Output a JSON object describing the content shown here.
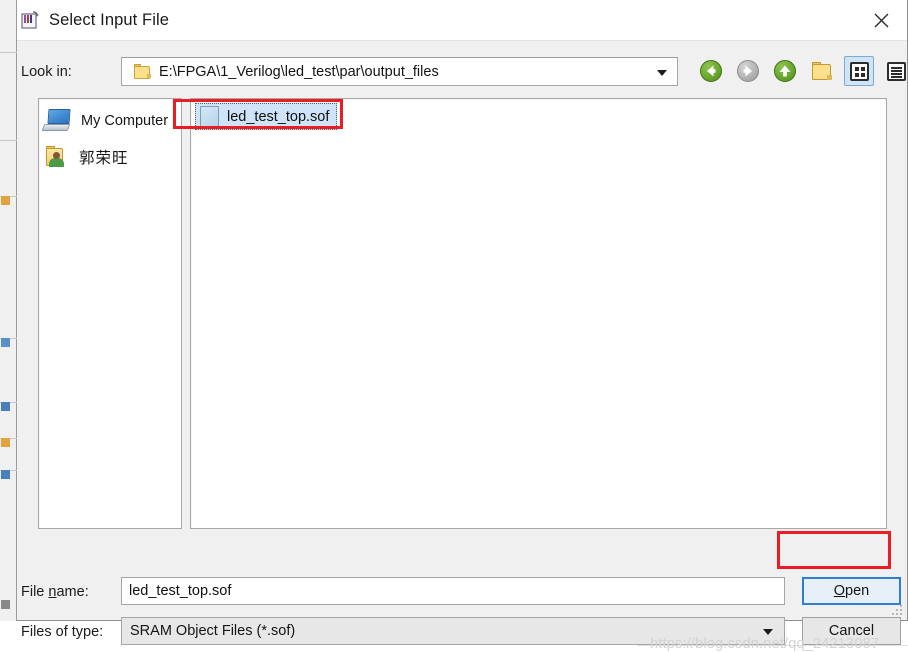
{
  "window": {
    "title": "Select Input File",
    "title_icon": "quartus-programmer-icon",
    "close_icon": "close-icon"
  },
  "lookin": {
    "label": "Look in:",
    "path": "E:\\FPGA\\1_Verilog\\led_test\\par\\output_files",
    "folder_icon": "folder-icon",
    "dropdown_icon": "chevron-down-icon"
  },
  "toolbar": {
    "buttons": [
      {
        "name": "back-button",
        "icon": "arrow-left-circle-icon",
        "state": "enabled"
      },
      {
        "name": "forward-button",
        "icon": "arrow-right-circle-icon",
        "state": "disabled"
      },
      {
        "name": "parent-directory-button",
        "icon": "arrow-up-circle-icon",
        "state": "enabled"
      },
      {
        "name": "new-folder-button",
        "icon": "folder-new-icon",
        "state": "enabled"
      },
      {
        "name": "list-view-button",
        "icon": "grid-view-icon",
        "state": "selected"
      },
      {
        "name": "detail-view-button",
        "icon": "list-detail-icon",
        "state": "enabled"
      }
    ]
  },
  "places": {
    "items": [
      {
        "label": "My Computer",
        "icon": "computer-icon"
      },
      {
        "label": "郭荣旺",
        "icon": "user-folder-icon"
      }
    ]
  },
  "file_list": {
    "files": [
      {
        "name": "led_test_top.sof",
        "icon": "sof-file-icon",
        "selected": true
      }
    ]
  },
  "file_name": {
    "label_before": "File ",
    "label_mnemonic": "n",
    "label_after": "ame:",
    "value": "led_test_top.sof",
    "placeholder": ""
  },
  "files_of_type": {
    "label": "Files of type:",
    "value": "SRAM Object Files (*.sof)",
    "dropdown_icon": "chevron-down-icon"
  },
  "buttons": {
    "open": {
      "mnemonic": "O",
      "rest": "pen",
      "focused": true
    },
    "cancel": {
      "label": "Cancel"
    }
  },
  "annotations": [
    {
      "name": "annotation-file-row",
      "color": "#ec1c24"
    },
    {
      "name": "annotation-open-button",
      "color": "#ec1c24"
    }
  ],
  "watermark": {
    "text": "https://blog.csdn.net/qq_24213087"
  },
  "colors": {
    "accent_blue": "#2f7fd0",
    "selection": "#cfe4f8",
    "annotation_red": "#ec1c24",
    "dialog_bg": "#f0f0f0"
  }
}
